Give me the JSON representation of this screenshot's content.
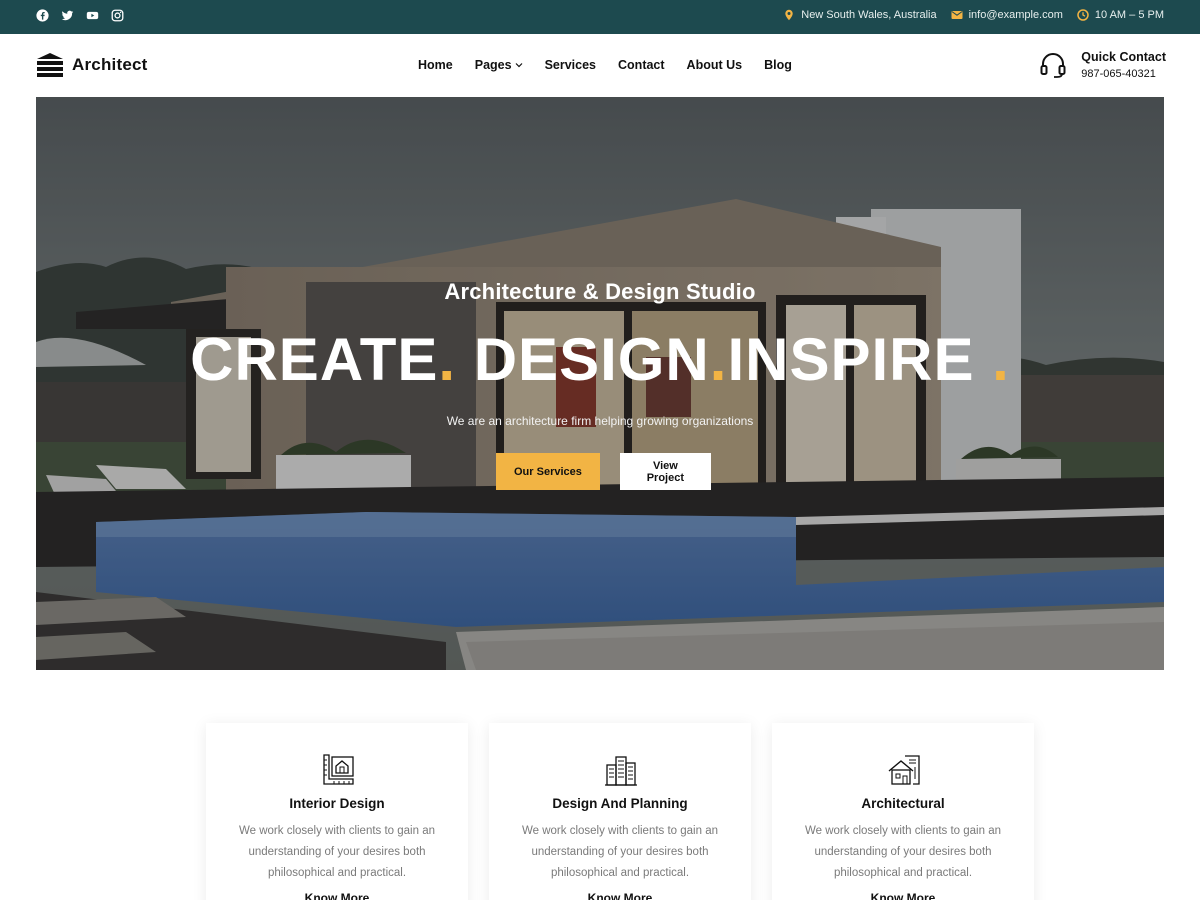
{
  "topbar": {
    "social": [
      "facebook-icon",
      "twitter-icon",
      "youtube-icon",
      "instagram-icon"
    ],
    "location": "New South Wales, Australia",
    "email": "info@example.com",
    "hours": "10 AM – 5 PM"
  },
  "header": {
    "brand": "Architect",
    "nav": [
      {
        "label": "Home"
      },
      {
        "label": "Pages"
      },
      {
        "label": "Services"
      },
      {
        "label": "Contact"
      },
      {
        "label": "About Us"
      },
      {
        "label": "Blog"
      }
    ],
    "quick_contact": {
      "title": "Quick Contact",
      "phone": "987-065-40321"
    }
  },
  "hero": {
    "subtitle": "Architecture & Design Studio",
    "headline": {
      "w1": "CREATE",
      "w2": "DESIGN",
      "w3": "INSPIRE",
      "dot": "."
    },
    "description": "We are an architecture firm helping growing organizations",
    "primary_button": "Our Services",
    "secondary_button": "View Project"
  },
  "cards": [
    {
      "title": "Interior Design",
      "text": "We work closely with clients to gain an understanding of your desires both philosophical and practical.",
      "link": "Know More"
    },
    {
      "title": "Design And Planning",
      "text": "We work closely with clients to gain an understanding of your desires both philosophical and practical.",
      "link": "Know More"
    },
    {
      "title": "Architectural",
      "text": "We work closely with clients to gain an understanding of your desires both philosophical and practical.",
      "link": "Know More"
    }
  ],
  "colors": {
    "topbar": "#1d4a4f",
    "accent": "#f2b444"
  }
}
